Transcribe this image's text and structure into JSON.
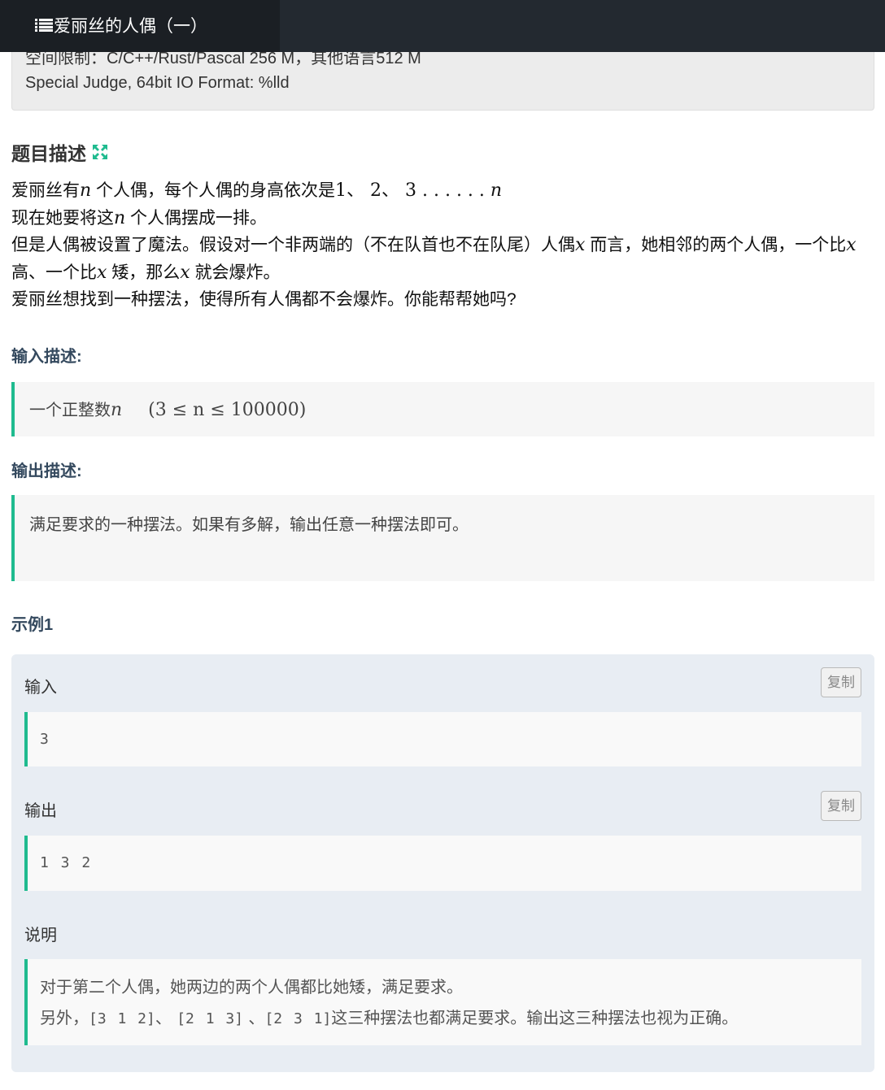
{
  "header": {
    "title": "爱丽丝的人偶（一）"
  },
  "info": {
    "limits_line": "空间限制：C/C++/Rust/Pascal 256 M，其他语言512 M",
    "judge_line": "Special Judge, 64bit IO Format: %lld"
  },
  "description": {
    "title": "题目描述",
    "p1_a": "爱丽丝有",
    "p1_n": "n",
    "p1_b": " 个人偶，每个人偶的身高依次是",
    "p1_seq": "1、 2、 3 . . . . . . ",
    "p1_end": "n",
    "p2_a": "现在她要将这",
    "p2_n": "n",
    "p2_b": " 个人偶摆成一排。",
    "p3_a": "但是人偶被设置了魔法。假设对一个非两端的（不在队首也不在队尾）人偶",
    "p3_x": "x",
    "p3_b": " 而言，她相邻的两个人偶，一个比",
    "p3_x2": "x",
    "p4_a": "高、一个比",
    "p4_x": "x",
    "p4_b": " 矮，那么",
    "p4_x2": "x",
    "p4_c": " 就会爆炸。",
    "p5": "爱丽丝想找到一种摆法，使得所有人偶都不会爆炸。你能帮帮她吗?"
  },
  "input_desc": {
    "title": "输入描述:",
    "text_a": "一个正整数",
    "text_n": "n",
    "range": "(3 ≤ n ≤ 100000)"
  },
  "output_desc": {
    "title": "输出描述:",
    "text": "满足要求的一种摆法。如果有多解，输出任意一种摆法即可。"
  },
  "example": {
    "title": "示例1",
    "input_label": "输入",
    "input_value": "3",
    "output_label": "输出",
    "output_value": "1 3 2",
    "copy_label": "复制",
    "note_label": "说明",
    "note_line1": "对于第二个人偶，她两边的两个人偶都比她矮，满足要求。",
    "note_line2_a": "另外，",
    "note_line2_b": "[3 1 2]",
    "note_line2_c": "、 ",
    "note_line2_d": "[2 1 3]",
    "note_line2_e": " 、",
    "note_line2_f": "[2 3 1]",
    "note_line2_g": "这三种摆法也都满足要求。输出这三种摆法也视为正确。"
  },
  "colors": {
    "accent": "#1fbb8f",
    "topbar": "#232930"
  }
}
